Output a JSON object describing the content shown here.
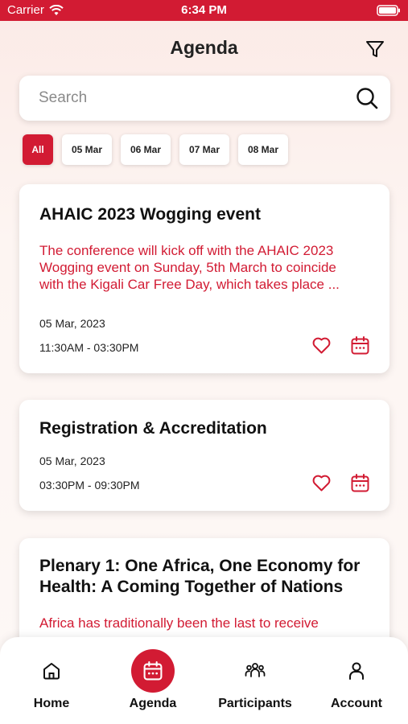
{
  "status_bar": {
    "carrier": "Carrier",
    "time": "6:34 PM"
  },
  "header": {
    "title": "Agenda"
  },
  "search": {
    "placeholder": "Search"
  },
  "date_filters": [
    "All",
    "05 Mar",
    "06 Mar",
    "07 Mar",
    "08 Mar"
  ],
  "selected_filter": "All",
  "events": [
    {
      "title": "AHAIC 2023 Wogging event",
      "description_lines": [
        "The conference will kick off with the AHAIC 2023",
        "Wogging event on Sunday, 5th March to coincide",
        "with the Kigali Car Free Day, which takes place ..."
      ],
      "date": "05 Mar, 2023",
      "time": "11:30AM - 03:30PM"
    },
    {
      "title": "Registration & Accreditation",
      "date": "05 Mar, 2023",
      "time": "03:30PM - 09:30PM"
    },
    {
      "title_lines": [
        "Plenary 1: One Africa, One Economy for",
        "Health: A Coming Together of Nations"
      ],
      "description_lines": [
        "Africa has traditionally been the last to receive"
      ]
    }
  ],
  "bottom_nav": {
    "items": [
      {
        "label": "Home",
        "icon": "home-icon"
      },
      {
        "label": "Agenda",
        "icon": "calendar-icon"
      },
      {
        "label": "Participants",
        "icon": "participants-icon"
      },
      {
        "label": "Account",
        "icon": "account-icon"
      }
    ],
    "active": "Agenda"
  },
  "colors": {
    "accent": "#d21b33",
    "background": "#fdf5f2",
    "card": "#ffffff"
  }
}
